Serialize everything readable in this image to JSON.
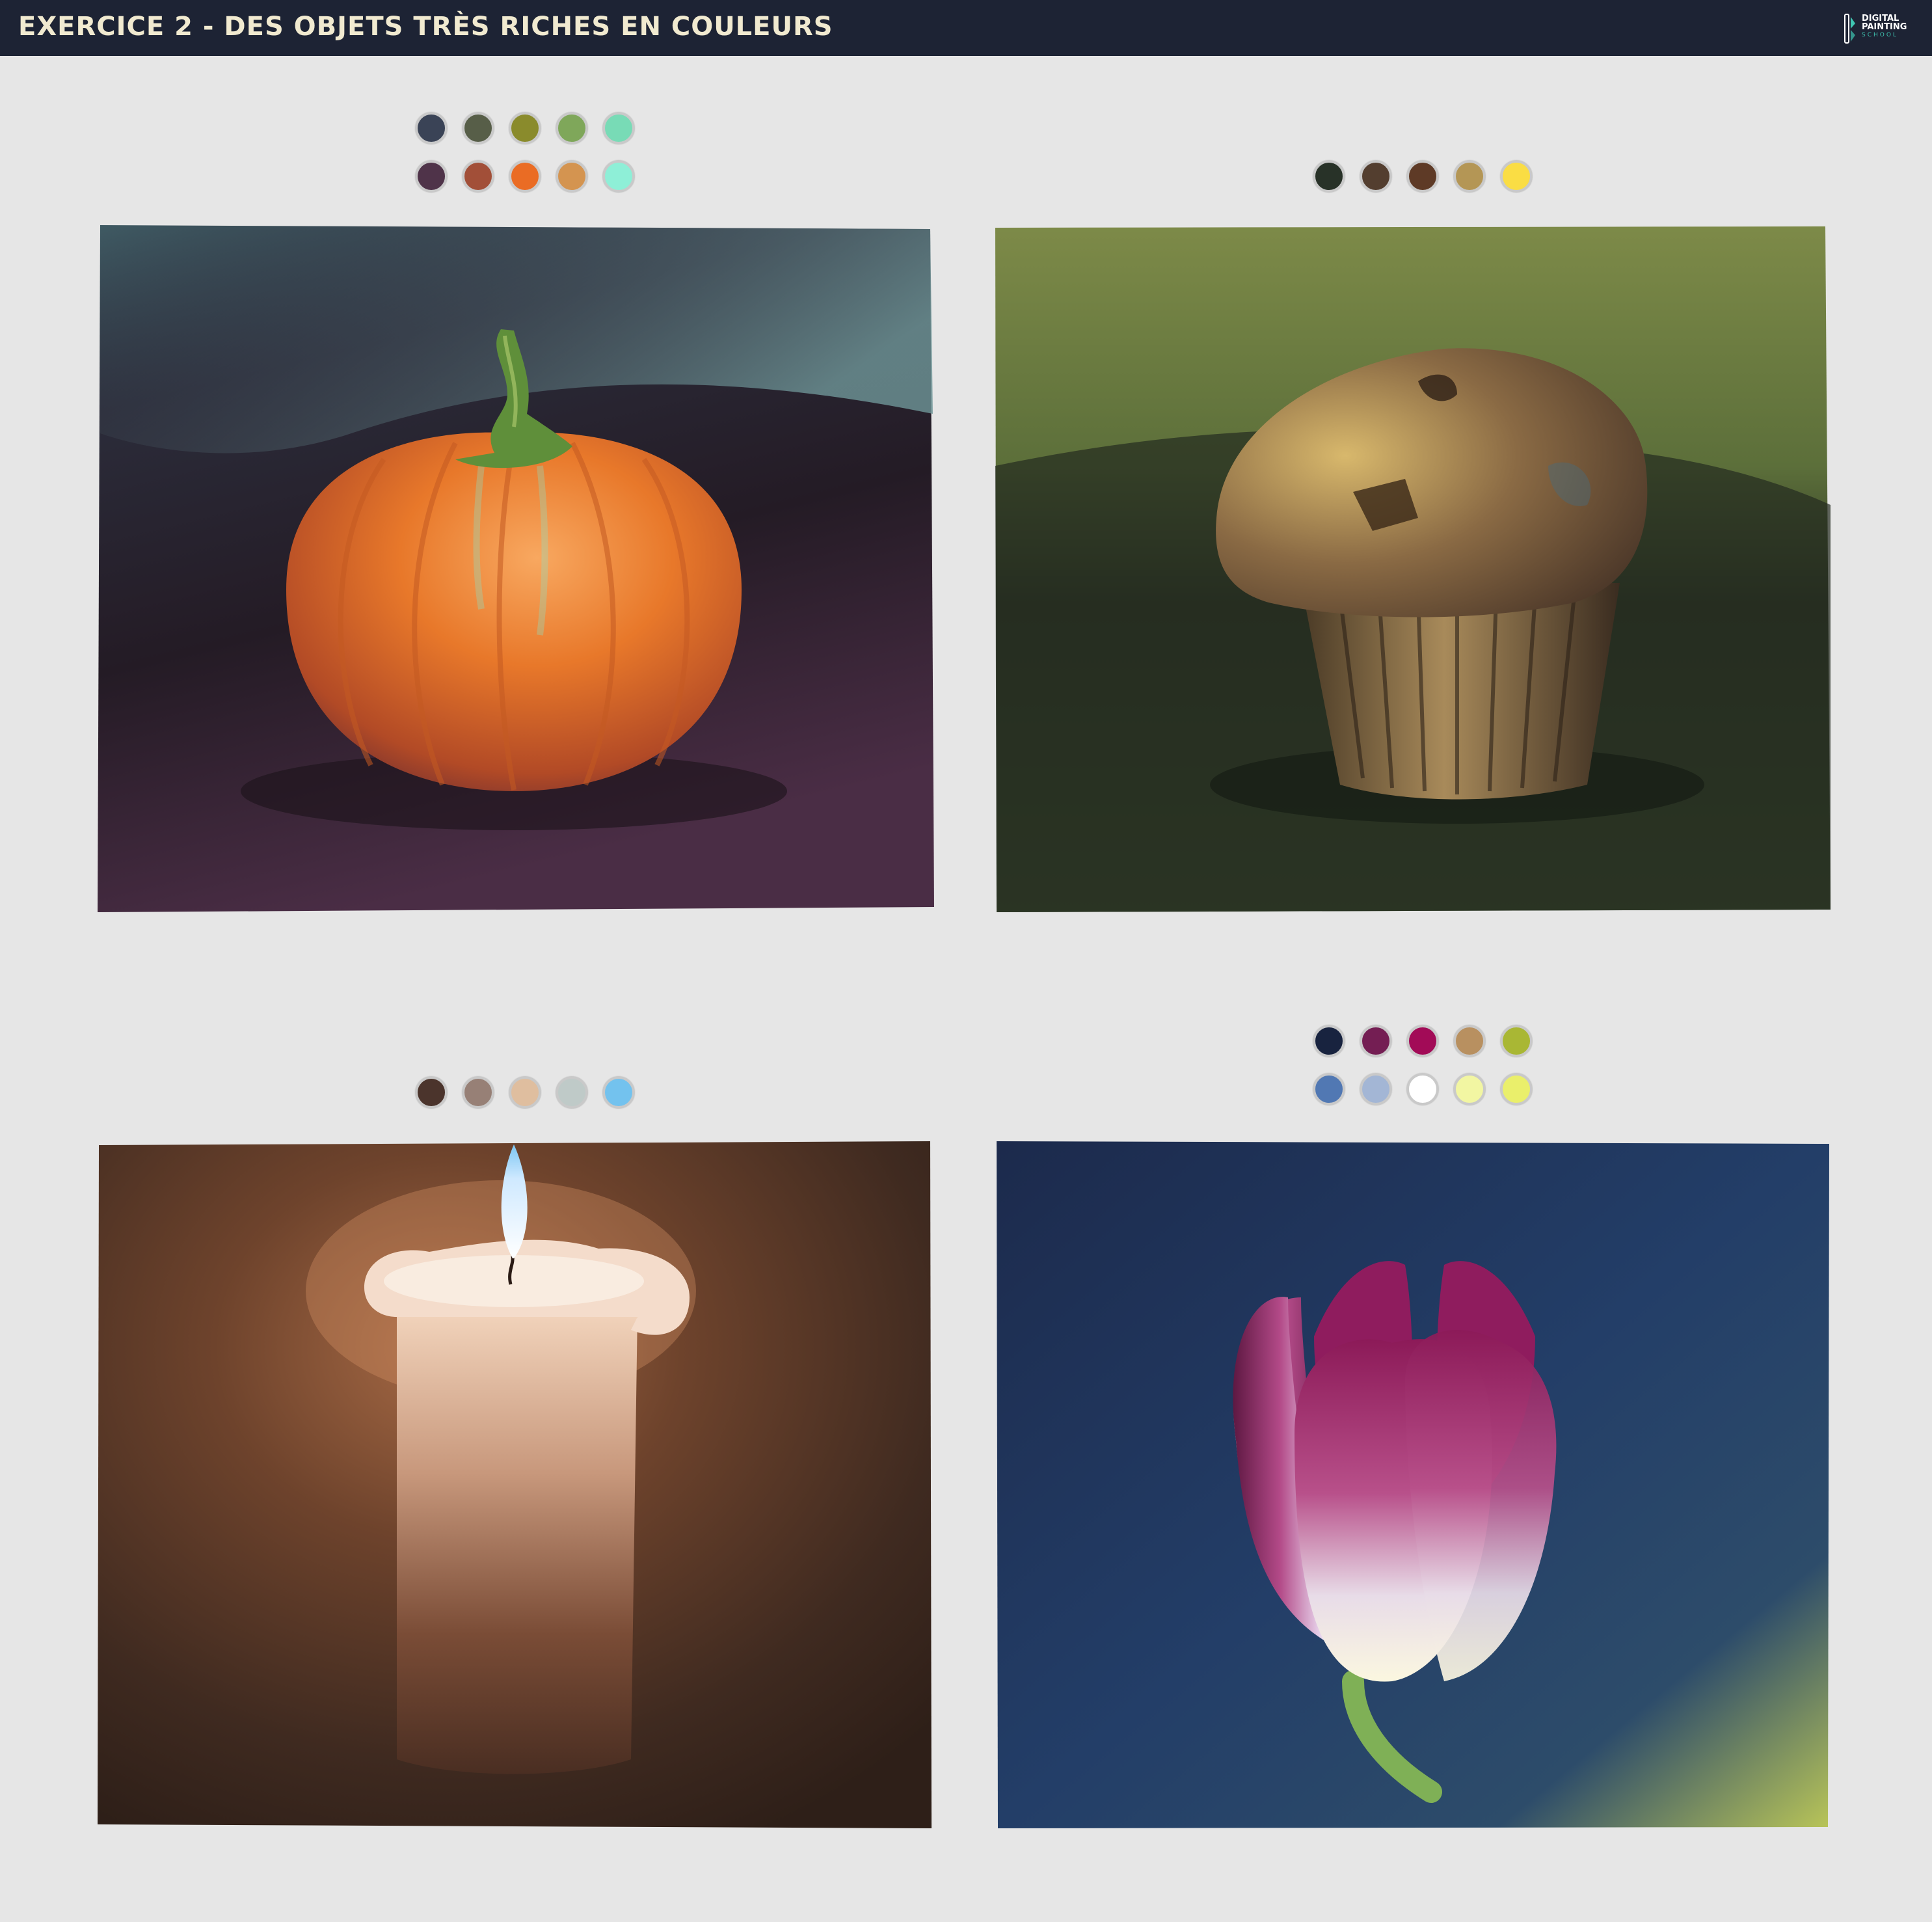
{
  "header": {
    "title": "EXERCICE 2 - DES OBJETS TRÈS RICHES EN COULEURS",
    "logo": {
      "line1": "DIGITAL",
      "line2": "PAINTING",
      "line3": "SCHOOL"
    }
  },
  "studies": [
    {
      "subject": "pumpkin",
      "palette": [
        "#3a4356",
        "#575e48",
        "#8a8b2c",
        "#7fa75a",
        "#78dbb6",
        "#4f3349",
        "#a24f38",
        "#ea6c24",
        "#d49450",
        "#8eefd7"
      ]
    },
    {
      "subject": "muffin",
      "palette": [
        "#283228",
        "#533e2f",
        "#5e3a26",
        "#b49655",
        "#fadd44"
      ]
    },
    {
      "subject": "candle",
      "palette": [
        "#4b342c",
        "#978076",
        "#dfbe9f",
        "#bfcac8",
        "#73c2ee"
      ]
    },
    {
      "subject": "tulip",
      "palette": [
        "#18233f",
        "#741e53",
        "#a20b57",
        "#b89060",
        "#a9b734",
        "#5178b3",
        "#a3b6d5",
        "#ffffff",
        "#f2f6a2",
        "#eaef6b"
      ]
    }
  ]
}
